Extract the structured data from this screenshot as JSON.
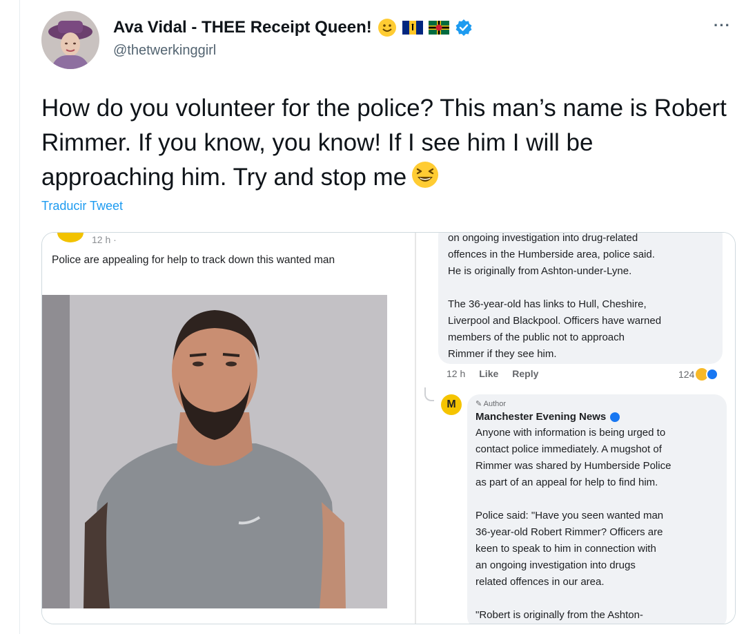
{
  "tweet": {
    "display_name": "Ava Vidal - THEE Receipt Queen!",
    "handle": "@thetwerkinggirl",
    "more_label": "···",
    "text": "How do you volunteer for the police? This man’s name is Robert Rimmer. If you know, you know! If I see him I will be approaching him. Try and stop me",
    "translate_label": "Traducir Tweet",
    "name_icons": [
      "smile-emoji",
      "barbados-flag",
      "dominica-flag",
      "verified-badge"
    ],
    "end_emoji": "laughing-emoji"
  },
  "media": {
    "post": {
      "time": "12 h · ",
      "caption": "Police are appealing for help to track down this wanted man"
    },
    "comment1": {
      "line1": "on ongoing investigation into drug-related",
      "line2": "offences in the Humberside area, police said.",
      "line3": "He is originally from Ashton-under-Lyne.",
      "line4": "The 36-year-old has links to Hull, Cheshire,",
      "line5": "Liverpool and Blackpool. Officers have warned",
      "line6": "members of the public not to approach",
      "line7": "Rimmer if they see him.",
      "time": "12 h",
      "like": "Like",
      "reply": "Reply",
      "reaction_count": "124"
    },
    "comment2": {
      "logo_letter": "M",
      "author_tag": "Author",
      "name": "Manchester Evening News",
      "line1": "Anyone with information is being urged to",
      "line2": "contact police immediately. A mugshot of",
      "line3": "Rimmer was shared by Humberside Police",
      "line4": "as part of an appeal for help to find him.",
      "line5": "Police said: \"Have you seen wanted man",
      "line6": "36-year-old Robert Rimmer? Officers are",
      "line7": "keen to speak to him in connection with",
      "line8": "an ongoing investigation into drugs",
      "line9": "related offences in our area.",
      "line10": "\"Robert is originally from the Ashton-"
    }
  },
  "colors": {
    "link": "#1d9bf0",
    "verified": "#1d9bf0",
    "text": "#0f1419",
    "secondary": "#536471"
  }
}
